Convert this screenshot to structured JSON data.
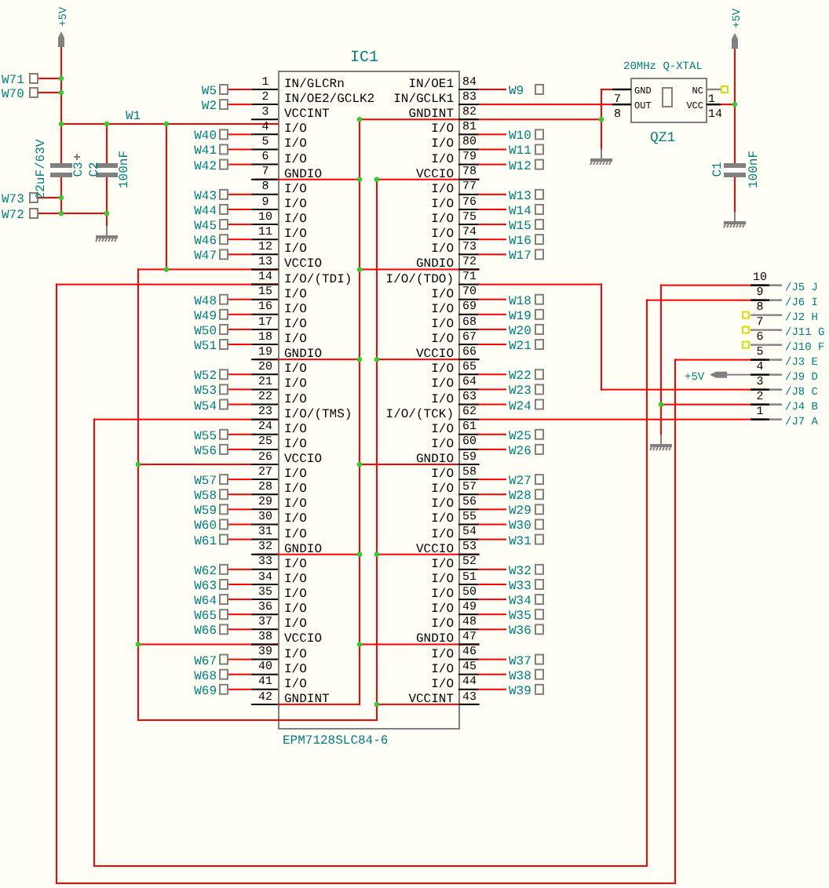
{
  "ic": {
    "ref": "IC1",
    "part": "EPM7128SLC84-6",
    "left_pins": [
      {
        "number": "1",
        "name": "IN/GLCRn",
        "net": "W5"
      },
      {
        "number": "2",
        "name": "IN/OE2/GCLK2",
        "net": "W2"
      },
      {
        "number": "3",
        "name": "VCCINT"
      },
      {
        "number": "4",
        "name": "I/O",
        "net": "W40"
      },
      {
        "number": "5",
        "name": "I/O",
        "net": "W41"
      },
      {
        "number": "6",
        "name": "I/O",
        "net": "W42"
      },
      {
        "number": "7",
        "name": "GNDIO"
      },
      {
        "number": "8",
        "name": "I/O",
        "net": "W43"
      },
      {
        "number": "9",
        "name": "I/O",
        "net": "W44"
      },
      {
        "number": "10",
        "name": "I/O",
        "net": "W45"
      },
      {
        "number": "11",
        "name": "I/O",
        "net": "W46"
      },
      {
        "number": "12",
        "name": "I/O",
        "net": "W47"
      },
      {
        "number": "13",
        "name": "VCCIO"
      },
      {
        "number": "14",
        "name": "I/O/(TDI)"
      },
      {
        "number": "15",
        "name": "I/O",
        "net": "W48"
      },
      {
        "number": "16",
        "name": "I/O",
        "net": "W49"
      },
      {
        "number": "17",
        "name": "I/O",
        "net": "W50"
      },
      {
        "number": "18",
        "name": "I/O",
        "net": "W51"
      },
      {
        "number": "19",
        "name": "GNDIO"
      },
      {
        "number": "20",
        "name": "I/O",
        "net": "W52"
      },
      {
        "number": "21",
        "name": "I/O",
        "net": "W53"
      },
      {
        "number": "22",
        "name": "I/O",
        "net": "W54"
      },
      {
        "number": "23",
        "name": "I/O/(TMS)"
      },
      {
        "number": "24",
        "name": "I/O",
        "net": "W55"
      },
      {
        "number": "25",
        "name": "I/O",
        "net": "W56"
      },
      {
        "number": "26",
        "name": "VCCIO"
      },
      {
        "number": "27",
        "name": "I/O",
        "net": "W57"
      },
      {
        "number": "28",
        "name": "I/O",
        "net": "W58"
      },
      {
        "number": "29",
        "name": "I/O",
        "net": "W59"
      },
      {
        "number": "30",
        "name": "I/O",
        "net": "W60"
      },
      {
        "number": "31",
        "name": "I/O",
        "net": "W61"
      },
      {
        "number": "32",
        "name": "GNDIO"
      },
      {
        "number": "33",
        "name": "I/O",
        "net": "W62"
      },
      {
        "number": "34",
        "name": "I/O",
        "net": "W63"
      },
      {
        "number": "35",
        "name": "I/O",
        "net": "W64"
      },
      {
        "number": "36",
        "name": "I/O",
        "net": "W65"
      },
      {
        "number": "37",
        "name": "I/O",
        "net": "W66"
      },
      {
        "number": "38",
        "name": "VCCIO"
      },
      {
        "number": "39",
        "name": "I/O",
        "net": "W67"
      },
      {
        "number": "40",
        "name": "I/O",
        "net": "W68"
      },
      {
        "number": "41",
        "name": "I/O",
        "net": "W69"
      },
      {
        "number": "42",
        "name": "GNDINT"
      }
    ],
    "right_pins": [
      {
        "number": "84",
        "name": "IN/OE1",
        "net": "W9"
      },
      {
        "number": "83",
        "name": "IN/GCLK1"
      },
      {
        "number": "82",
        "name": "GNDINT"
      },
      {
        "number": "81",
        "name": "I/O",
        "net": "W10"
      },
      {
        "number": "80",
        "name": "I/O",
        "net": "W11"
      },
      {
        "number": "79",
        "name": "I/O",
        "net": "W12"
      },
      {
        "number": "78",
        "name": "VCCIO"
      },
      {
        "number": "77",
        "name": "I/O",
        "net": "W13"
      },
      {
        "number": "76",
        "name": "I/O",
        "net": "W14"
      },
      {
        "number": "75",
        "name": "I/O",
        "net": "W15"
      },
      {
        "number": "74",
        "name": "I/O",
        "net": "W16"
      },
      {
        "number": "73",
        "name": "I/O",
        "net": "W17"
      },
      {
        "number": "72",
        "name": "GNDIO"
      },
      {
        "number": "71",
        "name": "I/O/(TDO)"
      },
      {
        "number": "70",
        "name": "I/O",
        "net": "W18"
      },
      {
        "number": "69",
        "name": "I/O",
        "net": "W19"
      },
      {
        "number": "68",
        "name": "I/O",
        "net": "W20"
      },
      {
        "number": "67",
        "name": "I/O",
        "net": "W21"
      },
      {
        "number": "66",
        "name": "VCCIO"
      },
      {
        "number": "65",
        "name": "I/O",
        "net": "W22"
      },
      {
        "number": "64",
        "name": "I/O",
        "net": "W23"
      },
      {
        "number": "63",
        "name": "I/O",
        "net": "W24"
      },
      {
        "number": "62",
        "name": "I/O/(TCK)"
      },
      {
        "number": "61",
        "name": "I/O",
        "net": "W25"
      },
      {
        "number": "60",
        "name": "I/O",
        "net": "W26"
      },
      {
        "number": "59",
        "name": "GNDIO"
      },
      {
        "number": "58",
        "name": "I/O",
        "net": "W27"
      },
      {
        "number": "57",
        "name": "I/O",
        "net": "W28"
      },
      {
        "number": "56",
        "name": "I/O",
        "net": "W29"
      },
      {
        "number": "55",
        "name": "I/O",
        "net": "W30"
      },
      {
        "number": "54",
        "name": "I/O",
        "net": "W31"
      },
      {
        "number": "53",
        "name": "VCCIO"
      },
      {
        "number": "52",
        "name": "I/O",
        "net": "W32"
      },
      {
        "number": "51",
        "name": "I/O",
        "net": "W33"
      },
      {
        "number": "50",
        "name": "I/O",
        "net": "W34"
      },
      {
        "number": "49",
        "name": "I/O",
        "net": "W35"
      },
      {
        "number": "48",
        "name": "I/O",
        "net": "W36"
      },
      {
        "number": "47",
        "name": "GNDIO"
      },
      {
        "number": "46",
        "name": "I/O",
        "net": "W37"
      },
      {
        "number": "45",
        "name": "I/O",
        "net": "W38"
      },
      {
        "number": "44",
        "name": "I/O",
        "net": "W39"
      },
      {
        "number": "43",
        "name": "VCCINT"
      }
    ]
  },
  "power_labels": [
    "+5V",
    "+5V",
    "+5V"
  ],
  "net_labels": [
    "W71",
    "W70",
    "W73",
    "W72",
    "W1"
  ],
  "capacitors": [
    {
      "ref": "C3",
      "value": "22uF/63V",
      "kind": "electrolytic"
    },
    {
      "ref": "C2",
      "value": "100nF",
      "kind": "ceramic"
    },
    {
      "ref": "C1",
      "value": "100nF",
      "kind": "ceramic"
    }
  ],
  "oscillator": {
    "ref": "QZ1",
    "title": "20MHz Q-XTAL",
    "pins": [
      {
        "number": "7",
        "name": "GND",
        "connected": true
      },
      {
        "number": "1",
        "name": "NC",
        "connected": false
      },
      {
        "number": "8",
        "name": "OUT",
        "connected": true
      },
      {
        "number": "14",
        "name": "VCC",
        "connected": true
      }
    ]
  },
  "connector": {
    "pins": [
      {
        "number": "10",
        "label": "/J5 J",
        "connected": true
      },
      {
        "number": "9",
        "label": "/J6 I",
        "connected": true
      },
      {
        "number": "8",
        "label": "/J2 H",
        "connected": false
      },
      {
        "number": "7",
        "label": "/J11 G",
        "connected": false
      },
      {
        "number": "6",
        "label": "/J10 F",
        "connected": false
      },
      {
        "number": "5",
        "label": "/J3 E",
        "connected": true
      },
      {
        "number": "4",
        "label": "/J9 D",
        "connected": true
      },
      {
        "number": "3",
        "label": "/J8 C",
        "connected": true
      },
      {
        "number": "2",
        "label": "/J4 B",
        "connected": true
      },
      {
        "number": "1",
        "label": "/J7 A",
        "connected": true
      }
    ]
  }
}
